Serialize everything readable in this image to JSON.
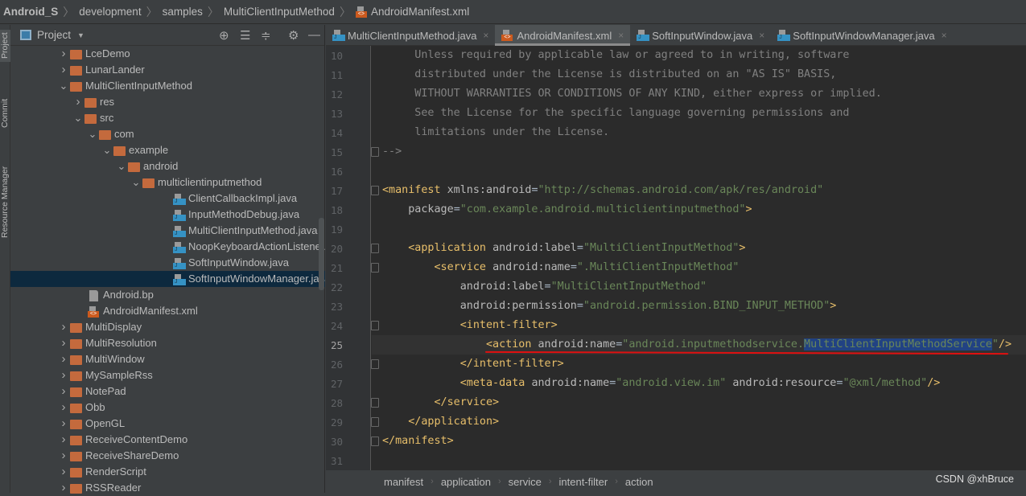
{
  "nav": {
    "crumbs": [
      "Android_S",
      "development",
      "samples",
      "MultiClientInputMethod",
      "AndroidManifest.xml"
    ]
  },
  "side_tabs": [
    "Project",
    "Commit",
    "Resource Manager"
  ],
  "project": {
    "title": "Project",
    "toolbar": [
      "locate-icon",
      "expand-all-icon",
      "collapse-all-icon",
      "gear-icon",
      "minimize-icon"
    ],
    "tree": [
      {
        "label": "LceDemo",
        "depth": 0,
        "type": "folder",
        "arrow": "right"
      },
      {
        "label": "LunarLander",
        "depth": 0,
        "type": "folder",
        "arrow": "right"
      },
      {
        "label": "MultiClientInputMethod",
        "depth": 0,
        "type": "folder",
        "arrow": "down"
      },
      {
        "label": "res",
        "depth": 1,
        "type": "folder",
        "arrow": "right"
      },
      {
        "label": "src",
        "depth": 1,
        "type": "folder",
        "arrow": "down"
      },
      {
        "label": "com",
        "depth": 2,
        "type": "folder",
        "arrow": "down"
      },
      {
        "label": "example",
        "depth": 3,
        "type": "folder",
        "arrow": "down"
      },
      {
        "label": "android",
        "depth": 4,
        "type": "folder",
        "arrow": "down"
      },
      {
        "label": "multiclientinputmethod",
        "depth": 5,
        "type": "folder",
        "arrow": "down"
      },
      {
        "label": "ClientCallbackImpl.java",
        "depth": 6,
        "type": "java"
      },
      {
        "label": "InputMethodDebug.java",
        "depth": 6,
        "type": "java"
      },
      {
        "label": "MultiClientInputMethod.java",
        "depth": 6,
        "type": "java"
      },
      {
        "label": "NoopKeyboardActionListener.java",
        "depth": 6,
        "type": "java"
      },
      {
        "label": "SoftInputWindow.java",
        "depth": 6,
        "type": "java"
      },
      {
        "label": "SoftInputWindowManager.java",
        "depth": 6,
        "type": "java",
        "selected": true
      },
      {
        "label": "Android.bp",
        "depth": 1,
        "type": "file"
      },
      {
        "label": "AndroidManifest.xml",
        "depth": 1,
        "type": "xml"
      },
      {
        "label": "MultiDisplay",
        "depth": 0,
        "type": "folder",
        "arrow": "right"
      },
      {
        "label": "MultiResolution",
        "depth": 0,
        "type": "folder",
        "arrow": "right"
      },
      {
        "label": "MultiWindow",
        "depth": 0,
        "type": "folder",
        "arrow": "right"
      },
      {
        "label": "MySampleRss",
        "depth": 0,
        "type": "folder",
        "arrow": "right"
      },
      {
        "label": "NotePad",
        "depth": 0,
        "type": "folder",
        "arrow": "right"
      },
      {
        "label": "Obb",
        "depth": 0,
        "type": "folder",
        "arrow": "right"
      },
      {
        "label": "OpenGL",
        "depth": 0,
        "type": "folder",
        "arrow": "right"
      },
      {
        "label": "ReceiveContentDemo",
        "depth": 0,
        "type": "folder",
        "arrow": "right"
      },
      {
        "label": "ReceiveShareDemo",
        "depth": 0,
        "type": "folder",
        "arrow": "right"
      },
      {
        "label": "RenderScript",
        "depth": 0,
        "type": "folder",
        "arrow": "right"
      },
      {
        "label": "RSSReader",
        "depth": 0,
        "type": "folder",
        "arrow": "right"
      }
    ]
  },
  "tabs": [
    {
      "label": "MultiClientInputMethod.java",
      "type": "java"
    },
    {
      "label": "AndroidManifest.xml",
      "type": "xml",
      "active": true
    },
    {
      "label": "SoftInputWindow.java",
      "type": "java"
    },
    {
      "label": "SoftInputWindowManager.java",
      "type": "java"
    }
  ],
  "editor": {
    "current_line": 25,
    "lines": [
      {
        "n": "10",
        "tokens": [
          [
            "comment",
            "     Unless required by applicable law or agreed to in writing, software"
          ]
        ]
      },
      {
        "n": "11",
        "tokens": [
          [
            "comment",
            "     distributed under the License is distributed on an \"AS IS\" BASIS,"
          ]
        ]
      },
      {
        "n": "12",
        "tokens": [
          [
            "comment",
            "     WITHOUT WARRANTIES OR CONDITIONS OF ANY KIND, either express or implied."
          ]
        ]
      },
      {
        "n": "13",
        "tokens": [
          [
            "comment",
            "     See the License for the specific language governing permissions and"
          ]
        ]
      },
      {
        "n": "14",
        "tokens": [
          [
            "comment",
            "     limitations under the License."
          ]
        ]
      },
      {
        "n": "15",
        "fold": true,
        "tokens": [
          [
            "comment",
            "-->"
          ]
        ]
      },
      {
        "n": "16",
        "tokens": []
      },
      {
        "n": "17",
        "fold": true,
        "tokens": [
          [
            "tag",
            "<manifest "
          ],
          [
            "attr",
            "xmlns:android"
          ],
          [
            "plain",
            "="
          ],
          [
            "val",
            "\"http://schemas.android.com/apk/res/android\""
          ]
        ]
      },
      {
        "n": "18",
        "tokens": [
          [
            "attr",
            "    package"
          ],
          [
            "plain",
            "="
          ],
          [
            "val",
            "\"com.example.android.multiclientinputmethod\""
          ],
          [
            "tag",
            ">"
          ]
        ]
      },
      {
        "n": "19",
        "tokens": []
      },
      {
        "n": "20",
        "fold": true,
        "tokens": [
          [
            "tag",
            "    <application "
          ],
          [
            "attr",
            "android:label"
          ],
          [
            "plain",
            "="
          ],
          [
            "val",
            "\"MultiClientInputMethod\""
          ],
          [
            "tag",
            ">"
          ]
        ]
      },
      {
        "n": "21",
        "fold": true,
        "tokens": [
          [
            "tag",
            "        <service "
          ],
          [
            "attr",
            "android:name"
          ],
          [
            "plain",
            "="
          ],
          [
            "val",
            "\".MultiClientInputMethod\""
          ]
        ]
      },
      {
        "n": "22",
        "tokens": [
          [
            "attr",
            "            android:label"
          ],
          [
            "plain",
            "="
          ],
          [
            "val",
            "\"MultiClientInputMethod\""
          ]
        ]
      },
      {
        "n": "23",
        "tokens": [
          [
            "attr",
            "            android:permission"
          ],
          [
            "plain",
            "="
          ],
          [
            "val",
            "\"android.permission.BIND_INPUT_METHOD\""
          ],
          [
            "tag",
            ">"
          ]
        ]
      },
      {
        "n": "24",
        "fold": true,
        "tokens": [
          [
            "tag",
            "            <intent-filter>"
          ]
        ]
      },
      {
        "n": "25",
        "tokens": [
          [
            "tag",
            "                <action "
          ],
          [
            "attr",
            "android:name"
          ],
          [
            "plain",
            "="
          ],
          [
            "val",
            "\"android.inputmethodservice."
          ],
          [
            "val selx",
            "MultiClientInputMethodService"
          ],
          [
            "val",
            "\""
          ],
          [
            "tag",
            "/>"
          ]
        ]
      },
      {
        "n": "26",
        "fold": true,
        "tokens": [
          [
            "tag",
            "            </intent-filter>"
          ]
        ]
      },
      {
        "n": "27",
        "tokens": [
          [
            "tag",
            "            <meta-data "
          ],
          [
            "attr",
            "android:name"
          ],
          [
            "plain",
            "="
          ],
          [
            "val",
            "\"android.view.im\""
          ],
          [
            "attr",
            " android:resource"
          ],
          [
            "plain",
            "="
          ],
          [
            "val",
            "\"@xml/method\""
          ],
          [
            "tag",
            "/>"
          ]
        ]
      },
      {
        "n": "28",
        "fold": true,
        "tokens": [
          [
            "tag",
            "        </service>"
          ]
        ]
      },
      {
        "n": "29",
        "fold": true,
        "tokens": [
          [
            "tag",
            "    </application>"
          ]
        ]
      },
      {
        "n": "30",
        "fold": true,
        "tokens": [
          [
            "tag",
            "</manifest>"
          ]
        ]
      },
      {
        "n": "31",
        "tokens": []
      }
    ]
  },
  "breadcrumb": [
    "manifest",
    "application",
    "service",
    "intent-filter",
    "action"
  ],
  "watermark": "CSDN @xhBruce"
}
